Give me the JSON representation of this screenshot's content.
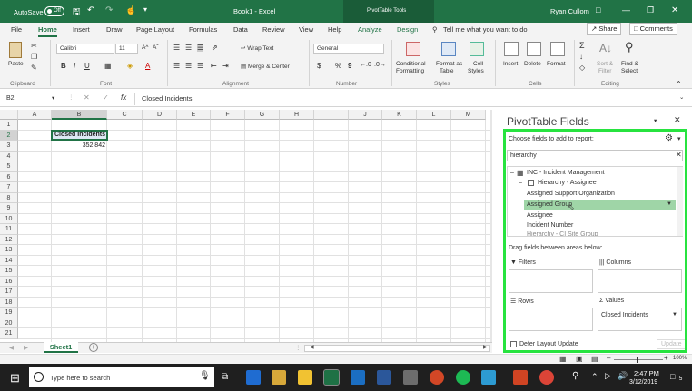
{
  "titlebar": {
    "autosave": "AutoSave",
    "toggle": "Off",
    "book": "Book1 - Excel",
    "pivot_tools": "PivotTable Tools",
    "user": "Ryan Cullom"
  },
  "tabs": [
    "File",
    "Home",
    "Insert",
    "Draw",
    "Page Layout",
    "Formulas",
    "Data",
    "Review",
    "View",
    "Help",
    "Analyze",
    "Design"
  ],
  "tell_me": "Tell me what you want to do",
  "share": "Share",
  "comments": "Comments",
  "ribbon": {
    "paste": "Paste",
    "font_name": "Calibri",
    "font_size": "11",
    "grow": "A^",
    "shrink": "Aˇ",
    "bold": "B",
    "italic": "I",
    "underline": "U",
    "wrap": "Wrap Text",
    "merge": "Merge & Center",
    "number_format": "General",
    "dollar": "$",
    "percent": "%",
    "comma": "9",
    "cond1": "Conditional",
    "cond2": "Formatting",
    "fmt1": "Format as",
    "fmt2": "Table",
    "cell1": "Cell",
    "cell2": "Styles",
    "insert": "Insert",
    "delete": "Delete",
    "format": "Format",
    "sort1": "Sort &",
    "sort2": "Filter",
    "find1": "Find &",
    "find2": "Select",
    "groups": {
      "clipboard": "Clipboard",
      "font": "Font",
      "alignment": "Alignment",
      "number": "Number",
      "styles": "Styles",
      "cells": "Cells",
      "editing": "Editing"
    }
  },
  "formula": {
    "namebox": "B2",
    "fx": "fx",
    "content": "Closed Incidents"
  },
  "grid": {
    "columns": [
      "A",
      "B",
      "C",
      "D",
      "E",
      "F",
      "G",
      "H",
      "I",
      "J",
      "K",
      "L",
      "M"
    ],
    "rows": [
      "1",
      "2",
      "3",
      "4",
      "5",
      "6",
      "7",
      "8",
      "9",
      "10",
      "11",
      "12",
      "13",
      "14",
      "15",
      "16",
      "17",
      "18",
      "19",
      "20",
      "21"
    ],
    "b2": "Closed Incidents",
    "b3": "352,842"
  },
  "sheet": {
    "name": "Sheet1",
    "add": "+"
  },
  "pivot": {
    "title": "PivotTable Fields",
    "choose": "Choose fields to add to report:",
    "search": "hierarchy",
    "fields": [
      "INC - Incident Management",
      "Hierarchy - Assignee",
      "Assigned Support Organization",
      "Assigned Group",
      "Assignee",
      "Incident Number"
    ],
    "partial": "Hierarchy - CI Site Group",
    "drag": "Drag fields between areas below:",
    "filters": "Filters",
    "columns": "Columns",
    "rows": "Rows",
    "values": "Values",
    "value_item": "Closed Incidents",
    "defer": "Defer Layout Update",
    "update": "Update"
  },
  "status": {
    "zoom": "100%"
  },
  "taskbar": {
    "search": "Type here to search",
    "time": "2:47 PM",
    "date": "3/12/2019",
    "notif": "5"
  }
}
